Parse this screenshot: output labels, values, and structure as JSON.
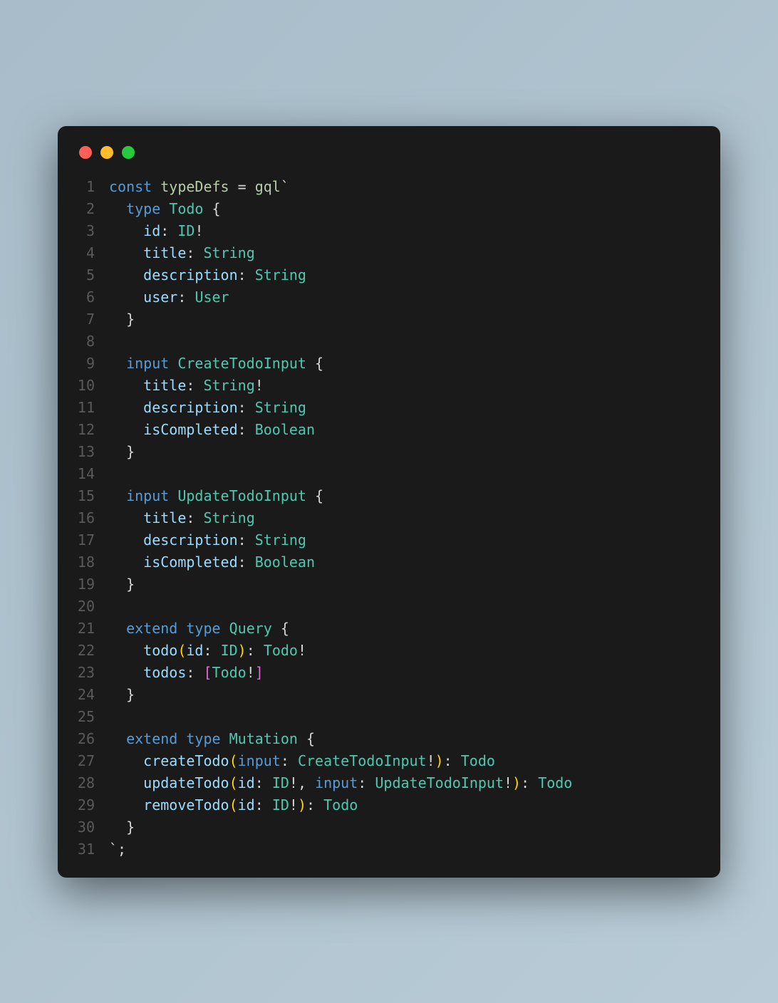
{
  "window": {
    "dots": [
      "red",
      "yellow",
      "green"
    ]
  },
  "code": {
    "lines": [
      {
        "n": "1",
        "tokens": [
          {
            "t": "const ",
            "c": "kw"
          },
          {
            "t": "typeDefs",
            "c": "fn"
          },
          {
            "t": " = ",
            "c": "op"
          },
          {
            "t": "gql",
            "c": "fn"
          },
          {
            "t": "`",
            "c": "tick"
          }
        ]
      },
      {
        "n": "2",
        "tokens": [
          {
            "t": "  ",
            "c": ""
          },
          {
            "t": "type ",
            "c": "kw"
          },
          {
            "t": "Todo",
            "c": "typename"
          },
          {
            "t": " {",
            "c": "brace"
          }
        ]
      },
      {
        "n": "3",
        "tokens": [
          {
            "t": "    ",
            "c": ""
          },
          {
            "t": "id",
            "c": "field"
          },
          {
            "t": ": ",
            "c": "punct"
          },
          {
            "t": "ID",
            "c": "typename"
          },
          {
            "t": "!",
            "c": "bang"
          }
        ]
      },
      {
        "n": "4",
        "tokens": [
          {
            "t": "    ",
            "c": ""
          },
          {
            "t": "title",
            "c": "field"
          },
          {
            "t": ": ",
            "c": "punct"
          },
          {
            "t": "String",
            "c": "typename"
          }
        ]
      },
      {
        "n": "5",
        "tokens": [
          {
            "t": "    ",
            "c": ""
          },
          {
            "t": "description",
            "c": "field"
          },
          {
            "t": ": ",
            "c": "punct"
          },
          {
            "t": "String",
            "c": "typename"
          }
        ]
      },
      {
        "n": "6",
        "tokens": [
          {
            "t": "    ",
            "c": ""
          },
          {
            "t": "user",
            "c": "field"
          },
          {
            "t": ": ",
            "c": "punct"
          },
          {
            "t": "User",
            "c": "typename"
          }
        ]
      },
      {
        "n": "7",
        "tokens": [
          {
            "t": "  }",
            "c": "brace"
          }
        ]
      },
      {
        "n": "8",
        "tokens": []
      },
      {
        "n": "9",
        "tokens": [
          {
            "t": "  ",
            "c": ""
          },
          {
            "t": "input ",
            "c": "kw"
          },
          {
            "t": "CreateTodoInput",
            "c": "typename"
          },
          {
            "t": " {",
            "c": "brace"
          }
        ]
      },
      {
        "n": "10",
        "tokens": [
          {
            "t": "    ",
            "c": ""
          },
          {
            "t": "title",
            "c": "field"
          },
          {
            "t": ": ",
            "c": "punct"
          },
          {
            "t": "String",
            "c": "typename"
          },
          {
            "t": "!",
            "c": "bang"
          }
        ]
      },
      {
        "n": "11",
        "tokens": [
          {
            "t": "    ",
            "c": ""
          },
          {
            "t": "description",
            "c": "field"
          },
          {
            "t": ": ",
            "c": "punct"
          },
          {
            "t": "String",
            "c": "typename"
          }
        ]
      },
      {
        "n": "12",
        "tokens": [
          {
            "t": "    ",
            "c": ""
          },
          {
            "t": "isCompleted",
            "c": "field"
          },
          {
            "t": ": ",
            "c": "punct"
          },
          {
            "t": "Boolean",
            "c": "typename"
          }
        ]
      },
      {
        "n": "13",
        "tokens": [
          {
            "t": "  }",
            "c": "brace"
          }
        ]
      },
      {
        "n": "14",
        "tokens": []
      },
      {
        "n": "15",
        "tokens": [
          {
            "t": "  ",
            "c": ""
          },
          {
            "t": "input ",
            "c": "kw"
          },
          {
            "t": "UpdateTodoInput",
            "c": "typename"
          },
          {
            "t": " {",
            "c": "brace"
          }
        ]
      },
      {
        "n": "16",
        "tokens": [
          {
            "t": "    ",
            "c": ""
          },
          {
            "t": "title",
            "c": "field"
          },
          {
            "t": ": ",
            "c": "punct"
          },
          {
            "t": "String",
            "c": "typename"
          }
        ]
      },
      {
        "n": "17",
        "tokens": [
          {
            "t": "    ",
            "c": ""
          },
          {
            "t": "description",
            "c": "field"
          },
          {
            "t": ": ",
            "c": "punct"
          },
          {
            "t": "String",
            "c": "typename"
          }
        ]
      },
      {
        "n": "18",
        "tokens": [
          {
            "t": "    ",
            "c": ""
          },
          {
            "t": "isCompleted",
            "c": "field"
          },
          {
            "t": ": ",
            "c": "punct"
          },
          {
            "t": "Boolean",
            "c": "typename"
          }
        ]
      },
      {
        "n": "19",
        "tokens": [
          {
            "t": "  }",
            "c": "brace"
          }
        ]
      },
      {
        "n": "20",
        "tokens": []
      },
      {
        "n": "21",
        "tokens": [
          {
            "t": "  ",
            "c": ""
          },
          {
            "t": "extend ",
            "c": "kw"
          },
          {
            "t": "type ",
            "c": "kw"
          },
          {
            "t": "Query",
            "c": "typename"
          },
          {
            "t": " {",
            "c": "brace"
          }
        ]
      },
      {
        "n": "22",
        "tokens": [
          {
            "t": "    ",
            "c": ""
          },
          {
            "t": "todo",
            "c": "field"
          },
          {
            "t": "(",
            "c": "paren"
          },
          {
            "t": "id",
            "c": "field"
          },
          {
            "t": ": ",
            "c": "punct"
          },
          {
            "t": "ID",
            "c": "typename"
          },
          {
            "t": ")",
            "c": "paren"
          },
          {
            "t": ": ",
            "c": "punct"
          },
          {
            "t": "Todo",
            "c": "typename"
          },
          {
            "t": "!",
            "c": "bang"
          }
        ]
      },
      {
        "n": "23",
        "tokens": [
          {
            "t": "    ",
            "c": ""
          },
          {
            "t": "todos",
            "c": "field"
          },
          {
            "t": ": ",
            "c": "punct"
          },
          {
            "t": "[",
            "c": "bracket"
          },
          {
            "t": "Todo",
            "c": "typename"
          },
          {
            "t": "!",
            "c": "bang"
          },
          {
            "t": "]",
            "c": "bracket"
          }
        ]
      },
      {
        "n": "24",
        "tokens": [
          {
            "t": "  }",
            "c": "brace"
          }
        ]
      },
      {
        "n": "25",
        "tokens": []
      },
      {
        "n": "26",
        "tokens": [
          {
            "t": "  ",
            "c": ""
          },
          {
            "t": "extend ",
            "c": "kw"
          },
          {
            "t": "type ",
            "c": "kw"
          },
          {
            "t": "Mutation",
            "c": "typename"
          },
          {
            "t": " {",
            "c": "brace"
          }
        ]
      },
      {
        "n": "27",
        "tokens": [
          {
            "t": "    ",
            "c": ""
          },
          {
            "t": "createTodo",
            "c": "field"
          },
          {
            "t": "(",
            "c": "paren"
          },
          {
            "t": "input",
            "c": "input-kw"
          },
          {
            "t": ": ",
            "c": "punct"
          },
          {
            "t": "CreateTodoInput",
            "c": "typename"
          },
          {
            "t": "!",
            "c": "bang"
          },
          {
            "t": ")",
            "c": "paren"
          },
          {
            "t": ": ",
            "c": "punct"
          },
          {
            "t": "Todo",
            "c": "typename"
          }
        ]
      },
      {
        "n": "28",
        "tokens": [
          {
            "t": "    ",
            "c": ""
          },
          {
            "t": "updateTodo",
            "c": "field"
          },
          {
            "t": "(",
            "c": "paren"
          },
          {
            "t": "id",
            "c": "field"
          },
          {
            "t": ": ",
            "c": "punct"
          },
          {
            "t": "ID",
            "c": "typename"
          },
          {
            "t": "!",
            "c": "bang"
          },
          {
            "t": ", ",
            "c": "punct"
          },
          {
            "t": "input",
            "c": "input-kw"
          },
          {
            "t": ": ",
            "c": "punct"
          },
          {
            "t": "UpdateTodoInput",
            "c": "typename"
          },
          {
            "t": "!",
            "c": "bang"
          },
          {
            "t": ")",
            "c": "paren"
          },
          {
            "t": ": ",
            "c": "punct"
          },
          {
            "t": "Todo",
            "c": "typename"
          }
        ]
      },
      {
        "n": "29",
        "tokens": [
          {
            "t": "    ",
            "c": ""
          },
          {
            "t": "removeTodo",
            "c": "field"
          },
          {
            "t": "(",
            "c": "paren"
          },
          {
            "t": "id",
            "c": "field"
          },
          {
            "t": ": ",
            "c": "punct"
          },
          {
            "t": "ID",
            "c": "typename"
          },
          {
            "t": "!",
            "c": "bang"
          },
          {
            "t": ")",
            "c": "paren"
          },
          {
            "t": ": ",
            "c": "punct"
          },
          {
            "t": "Todo",
            "c": "typename"
          }
        ]
      },
      {
        "n": "30",
        "tokens": [
          {
            "t": "  }",
            "c": "brace"
          }
        ]
      },
      {
        "n": "31",
        "tokens": [
          {
            "t": "`",
            "c": "tick"
          },
          {
            "t": ";",
            "c": "punct"
          }
        ]
      }
    ]
  }
}
